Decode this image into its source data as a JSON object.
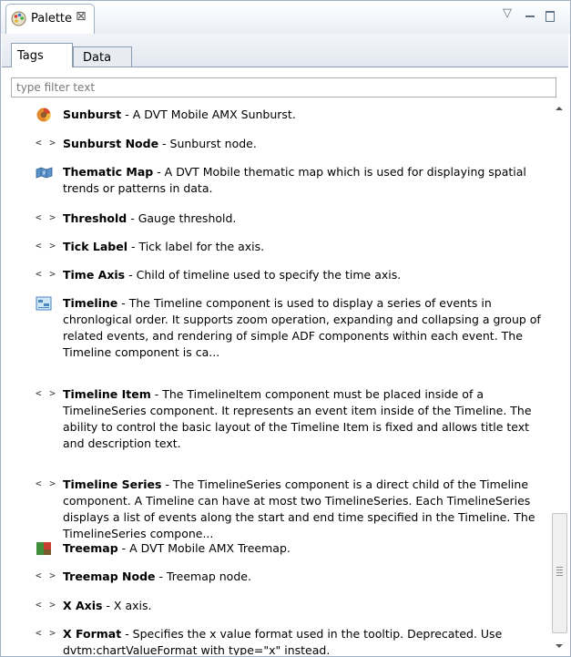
{
  "view": {
    "title": "Palette",
    "close_glyph": "⊠",
    "menu_glyph": "▽"
  },
  "tabs": [
    {
      "label": "Tags",
      "active": true
    },
    {
      "label": "Data",
      "active": false
    }
  ],
  "filter": {
    "placeholder": "type filter text",
    "value": ""
  },
  "items": [
    {
      "icon": "sunburst-icon",
      "name": "Sunburst",
      "desc": " - A DVT Mobile AMX Sunburst."
    },
    {
      "icon": "tag-icon",
      "name": "Sunburst Node",
      "desc": " - Sunburst node."
    },
    {
      "icon": "thematic-map-icon",
      "name": "Thematic Map",
      "desc": " - A DVT Mobile thematic map which is used for displaying spatial trends or patterns in data."
    },
    {
      "icon": "tag-icon",
      "name": "Threshold",
      "desc": " - Gauge threshold."
    },
    {
      "icon": "tag-icon",
      "name": "Tick Label",
      "desc": " - Tick label for the axis."
    },
    {
      "icon": "tag-icon",
      "name": "Time Axis",
      "desc": " - Child of timeline used to specify the time axis."
    },
    {
      "icon": "timeline-icon",
      "name": "Timeline",
      "desc": " - The Timeline component is used to display a series of events in chronlogical order. It supports zoom operation, expanding and collapsing a group of related events, and rendering of simple ADF components within each event. The Timeline component is ca..."
    },
    {
      "icon": "tag-icon",
      "name": "Timeline Item",
      "desc": " - The TimelineItem component must be placed inside of a TimelineSeries component. It represents an event item inside of the Timeline. The ability to control the basic layout of the Timeline Item is fixed and allows title text and description text."
    },
    {
      "icon": "tag-icon",
      "name": "Timeline Series",
      "desc": " - The TimelineSeries component is a direct child of the Timeline component. A Timeline can have at most two TimelineSeries. Each TimelineSeries displays a list of events along the start and end time specified in the Timeline. The TimelineSeries compone..."
    },
    {
      "icon": "treemap-icon",
      "name": "Treemap",
      "desc": " - A DVT Mobile AMX Treemap."
    },
    {
      "icon": "tag-icon",
      "name": "Treemap Node",
      "desc": " - Treemap node."
    },
    {
      "icon": "tag-icon",
      "name": "X Axis",
      "desc": " - X axis."
    },
    {
      "icon": "tag-icon",
      "name": "X Format",
      "desc": " - Specifies the x value format used in the tooltip. Deprecated. Use dvtm:chartValueFormat with type=\"x\" instead."
    }
  ],
  "tag_glyph": "< >",
  "colors": {
    "border": "#a0afc3",
    "toolbar_icons": "#607087"
  }
}
